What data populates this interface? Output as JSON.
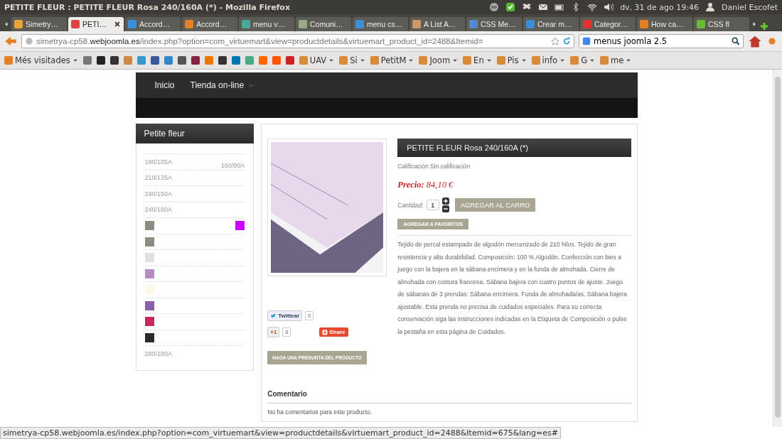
{
  "window": {
    "title": "PETITE FLEUR : PETITE FLEUR Rosa 240/160A (*) - Mozilla Firefox"
  },
  "system_tray": {
    "clock": "dv, 31 de ago 19:46",
    "user": "Daniel Escofet"
  },
  "tabs": [
    {
      "label": "Simetry…",
      "selected": false
    },
    {
      "label": "PETI…",
      "selected": true
    },
    {
      "label": "Accord…",
      "selected": false
    },
    {
      "label": "Accord…",
      "selected": false
    },
    {
      "label": "menu v…",
      "selected": false
    },
    {
      "label": "Comuni…",
      "selected": false
    },
    {
      "label": "menu cs…",
      "selected": false
    },
    {
      "label": "A List A…",
      "selected": false
    },
    {
      "label": "CSS Me…",
      "selected": false
    },
    {
      "label": "Crear m…",
      "selected": false
    },
    {
      "label": "Categor…",
      "selected": false
    },
    {
      "label": "How ca…",
      "selected": false
    },
    {
      "label": "CSS fl",
      "selected": false
    }
  ],
  "navigation": {
    "url": "simetrya-cp58.**webjoomla.es**/index.php?option=com_virtuemart&view=productdetails&virtuemart_product_id=2488&Itemid=",
    "search_value": "menus joomla 2.5"
  },
  "bookmarks": {
    "most_visited": "Més visitades",
    "folders": [
      "UAV",
      "Si",
      "PetitM",
      "Joom",
      "En",
      "Pis",
      "info",
      "G",
      "me"
    ]
  },
  "site_menu": [
    {
      "label": "Inicio",
      "dropdown": false
    },
    {
      "label": "Tienda on-line",
      "dropdown": true
    }
  ],
  "sidebar": {
    "title": "Petite fleur",
    "items": [
      {
        "kind": "size",
        "label": "180/105A",
        "extra": {
          "kind": "size",
          "label": "160/90A"
        }
      },
      {
        "kind": "size",
        "label": "210/135A"
      },
      {
        "kind": "size",
        "label": "240/150A"
      },
      {
        "kind": "size",
        "label": "240/160A"
      },
      {
        "kind": "swatch",
        "color": "#8d8d82",
        "extra": {
          "kind": "swatch",
          "color": "#cc00ff"
        }
      },
      {
        "kind": "swatch",
        "color": "#8d8d82"
      },
      {
        "kind": "swatch",
        "color": "#e0e0e0"
      },
      {
        "kind": "swatch",
        "color": "#b48cc0"
      },
      {
        "kind": "swatch",
        "color": "#fdf8e8"
      },
      {
        "kind": "swatch",
        "color": "#8b5ea8"
      },
      {
        "kind": "swatch",
        "color": "#c8285a"
      },
      {
        "kind": "swatch",
        "color": "#2b2b2b"
      },
      {
        "kind": "size",
        "label": "280/180A"
      }
    ]
  },
  "product": {
    "title": "PETITE FLEUR Rosa 240/160A (*)",
    "rating": "Calificación Sin calificación",
    "price_label": "Precio:",
    "price": "84,10 €",
    "quantity_label": "Cantidad:",
    "quantity": "1",
    "add_to_cart": "AGREGAR AL CARRO",
    "add_to_favorites": "AGREGAR A FAVORITOS",
    "description": "Tejido de percal estampado de algodón mercerizado de 210 hilos. Tejido de gran resistencia y alta durabilidad. Composición:  100 %    Algodón. Confección con bies a juego con la bajera en la sábana encimera y en la funda de almohada. Cierre de almohada con costura francesa. Sábana bajera con cuatro puntos de ajuste. Juego de sábanas de 3 prendas: Sábana encimera. Funda de almohada/as. Sábana bajera ajustable. Esta prenda no precisa de cuidados especiales. Para su correcta conservación siga las instrucciones indicadas en la Etiqueta de Composición o pulse la pestaña en esta página de Cuidados.",
    "social": {
      "tweet": "Twittear",
      "tweet_count": "0",
      "plus_one": "+1",
      "plus_count": "0",
      "share": "Share"
    },
    "ask_question": "HAGA UNA PREGUNTA DEL PRODUCTO"
  },
  "comments": {
    "title": "Comentario",
    "empty": "No ha comentarios para este producto."
  },
  "status_bar": "simetrya-cp58.webjoomla.es/index.php?option=com_virtuemart&view=productdetails&virtuemart_product_id=2488&Itemid=675&lang=es#"
}
